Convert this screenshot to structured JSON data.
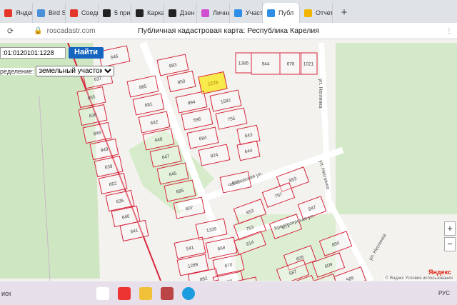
{
  "tabs": [
    {
      "label": "Яндекс",
      "color": "#e5362a"
    },
    {
      "label": "Bird So",
      "color": "#4a90d9"
    },
    {
      "label": "Соеди",
      "color": "#e5362a"
    },
    {
      "label": "5 приз",
      "color": "#222222"
    },
    {
      "label": "Каркас",
      "color": "#222222"
    },
    {
      "label": "Дзен",
      "color": "#222222"
    },
    {
      "label": "Личны",
      "color": "#d04fd0"
    },
    {
      "label": "Участ",
      "color": "#2f8ee5"
    },
    {
      "label": "Публ",
      "color": "#2f8ee5",
      "active": true
    },
    {
      "label": "Отчет",
      "color": "#f2b600"
    }
  ],
  "address": {
    "url": "roscadastr.com",
    "page_title": "Публичная кадастровая карта: Республика Карелия"
  },
  "search": {
    "value": ":01:0120101:1228",
    "button": "Найти"
  },
  "definition": {
    "label": "ределение:",
    "selected": "земельный участок"
  },
  "zoom": {
    "in": "+",
    "out": "−"
  },
  "attribution": {
    "logo": "Яндекс",
    "text": "© Яндекс Условия использования"
  },
  "streets": [
    "Чогозерская ул.",
    "Крестозерская ул.",
    "ул. Неглинка",
    "ул. Неглинка",
    "ул. Неглинка"
  ],
  "highlight_parcel": "1228",
  "parcel_numbers": [
    "646",
    "637",
    "883",
    "955",
    "885",
    "950",
    "1228",
    "638",
    "681",
    "994",
    "1582",
    "848",
    "642",
    "596",
    "755",
    "949",
    "648",
    "684",
    "643",
    "639",
    "647",
    "824",
    "644",
    "662",
    "645",
    "837",
    "636",
    "685",
    "640",
    "607",
    "641",
    "1339",
    "541",
    "668",
    "1289",
    "670",
    "892",
    "600",
    "851",
    "609",
    "1385",
    "944",
    "676",
    "1021",
    "853",
    "757",
    "653",
    "847",
    "753",
    "671",
    "614",
    "605",
    "850",
    "587",
    "609",
    "585",
    "607",
    "561"
  ],
  "taskbar": {
    "search_text": "иск",
    "lang": "РУС"
  },
  "colors": {
    "parcel_line": "#d7263d",
    "highlight_fill": "#f7ea4a",
    "forest": "#cfe6c2",
    "accent": "#1565c0"
  }
}
